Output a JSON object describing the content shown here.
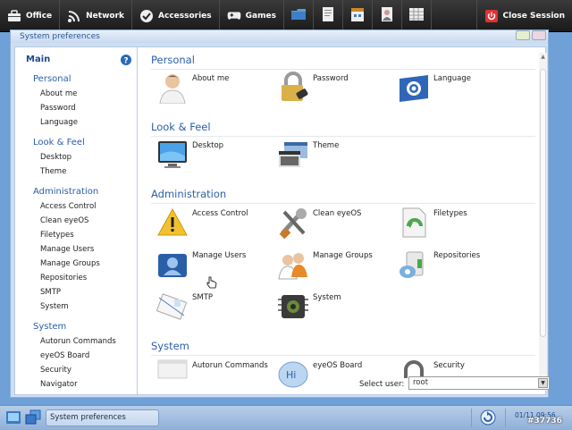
{
  "topbar": {
    "items": [
      {
        "label": "Office",
        "icon": "briefcase-icon"
      },
      {
        "label": "Network",
        "icon": "wifi-icon"
      },
      {
        "label": "Accessories",
        "icon": "accessories-icon"
      },
      {
        "label": "Games",
        "icon": "gamepad-icon"
      }
    ],
    "quick_icons": [
      "folder-icon",
      "document-icon",
      "calendar-icon",
      "contacts-icon",
      "spreadsheet-icon"
    ],
    "close_session": "Close Session"
  },
  "window": {
    "title": "System preferences"
  },
  "sidebar": {
    "main": "Main",
    "categories": [
      {
        "label": "Personal",
        "items": [
          "About me",
          "Password",
          "Language"
        ]
      },
      {
        "label": "Look & Feel",
        "items": [
          "Desktop",
          "Theme"
        ]
      },
      {
        "label": "Administration",
        "items": [
          "Access Control",
          "Clean eyeOS",
          "Filetypes",
          "Manage Users",
          "Manage Groups",
          "Repositories",
          "SMTP",
          "System"
        ]
      },
      {
        "label": "System",
        "items": [
          "Autorun Commands",
          "eyeOS Board",
          "Security",
          "Navigator"
        ]
      }
    ]
  },
  "sections": [
    {
      "title": "Personal",
      "items": [
        "About me",
        "Password",
        "Language"
      ]
    },
    {
      "title": "Look & Feel",
      "items": [
        "Desktop",
        "Theme"
      ]
    },
    {
      "title": "Administration",
      "items": [
        "Access Control",
        "Clean eyeOS",
        "Filetypes",
        "Manage Users",
        "Manage Groups",
        "Repositories",
        "SMTP",
        "System"
      ]
    },
    {
      "title": "System",
      "items": [
        "Autorun Commands",
        "eyeOS Board",
        "Security"
      ]
    }
  ],
  "select_user": {
    "label": "Select user:",
    "value": "root"
  },
  "taskbar": {
    "task_label": "System preferences",
    "clock": "01/11 09:56"
  },
  "watermark": "#37736"
}
